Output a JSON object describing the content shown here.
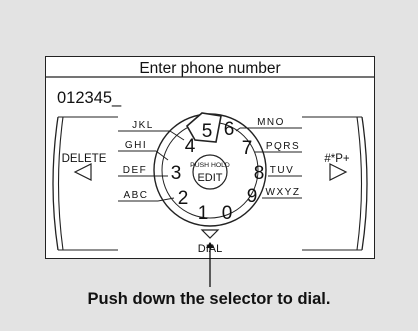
{
  "screen": {
    "title": "Enter phone number",
    "number_value": "012345_"
  },
  "controls": {
    "delete_label": "DELETE",
    "delete_icon": "triangle-left-icon",
    "symbols_label": "#*P+",
    "symbols_icon": "triangle-right-icon",
    "center_top": "PUSH HOLD",
    "center_bottom": "EDIT",
    "dial_label": "DIAL",
    "dial_icon": "triangle-down-icon"
  },
  "dial": {
    "selected_digit": "5",
    "digits": [
      "1",
      "2",
      "3",
      "4",
      "5",
      "6",
      "7",
      "8",
      "9",
      "0"
    ],
    "letters": {
      "left": [
        "JKL",
        "GHI",
        "DEF",
        "ABC"
      ],
      "right": [
        "MNO",
        "PQRS",
        "TUV",
        "WXYZ"
      ]
    }
  },
  "caption": "Push down the selector to dial.",
  "colors": {
    "background": "#e3e3e3",
    "screen": "#ffffff",
    "ink": "#111111"
  }
}
